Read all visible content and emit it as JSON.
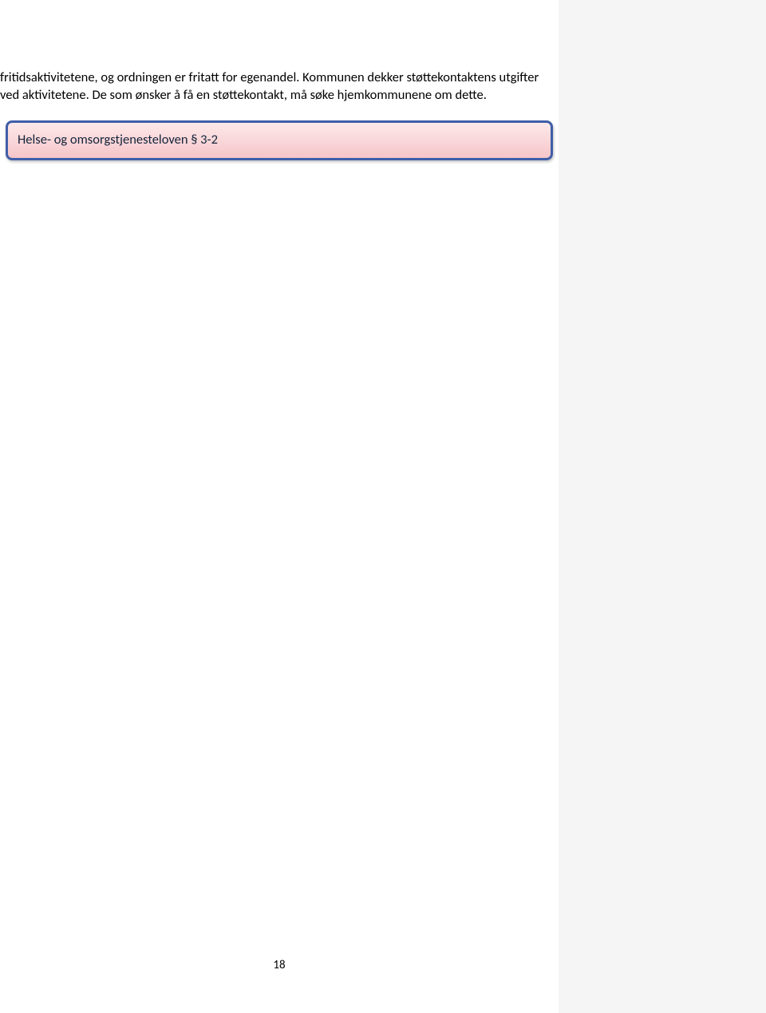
{
  "body_text": "fritidsaktivitetene, og ordningen er fritatt for egenandel. Kommunen dekker støttekontaktens utgifter ved aktivitetene. De som ønsker å få en støttekontakt, må søke hjemkommunene om dette.",
  "callout_text": "Helse- og omsorgstjenesteloven § 3-2",
  "page_number": "18"
}
